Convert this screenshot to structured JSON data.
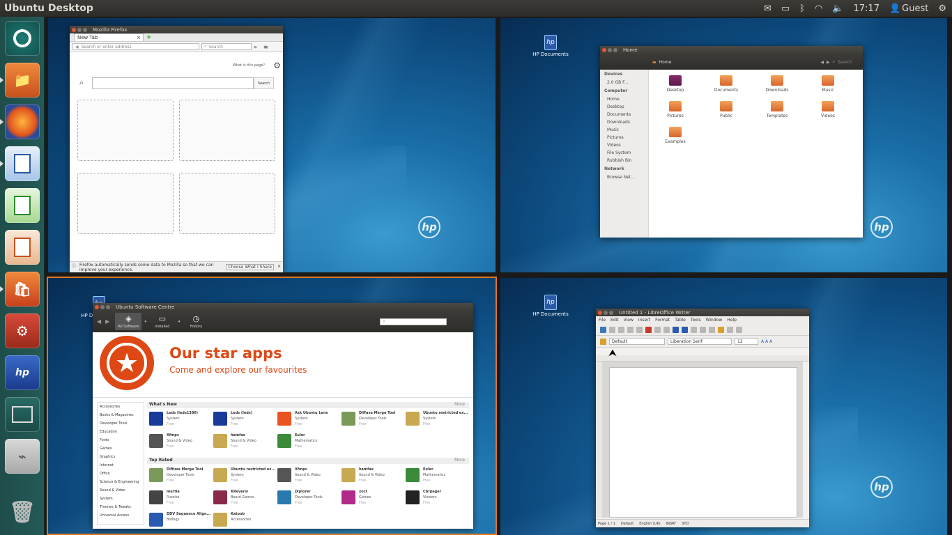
{
  "panel": {
    "title": "Ubuntu Desktop",
    "time": "17:17",
    "user": "Guest"
  },
  "launcher": {
    "items": [
      "Dash Home",
      "Files",
      "Firefox Web Browser",
      "LibreOffice Writer",
      "LibreOffice Calc",
      "LibreOffice Impress",
      "Ubuntu Software Centre",
      "System Settings",
      "HP Documents",
      "Workspace Switcher",
      "USB Drive",
      "Trash"
    ]
  },
  "desktop": {
    "hp_documents": "HP Documents",
    "hp_logo": "hp"
  },
  "firefox": {
    "title": "Mozilla Firefox",
    "tab": "New Tab",
    "address_placeholder": "Search or enter address",
    "search_placeholder": "Search",
    "whats_this": "What is this page?",
    "search_button": "Search",
    "notice": "Firefox automatically sends some data to Mozilla so that we can improve your experience.",
    "choose": "Choose What I Share"
  },
  "files": {
    "title": "Home",
    "breadcrumb": "Home",
    "search": "Search",
    "devices_h": "Devices",
    "device": "2.0 GB F...",
    "computer_h": "Computer",
    "computer": [
      "Home",
      "Desktop",
      "Documents",
      "Downloads",
      "Music",
      "Pictures",
      "Videos",
      "File System",
      "Rubbish Bin"
    ],
    "network_h": "Network",
    "network": [
      "Browse Net..."
    ],
    "folders": [
      "Desktop",
      "Documents",
      "Downloads",
      "Music",
      "Pictures",
      "Public",
      "Templates",
      "Videos",
      "Examples"
    ]
  },
  "software": {
    "title": "Ubuntu Software Centre",
    "nav": [
      "All Software",
      "Installed",
      "History"
    ],
    "banner_title": "Our star apps",
    "banner_sub": "Come and explore our favourites",
    "categories": [
      "Accessories",
      "Books & Magazines",
      "Developer Tools",
      "Education",
      "Fonts",
      "Games",
      "Graphics",
      "Internet",
      "Office",
      "Science & Engineering",
      "Sound & Video",
      "System",
      "Themes & Tweaks",
      "Universal Access"
    ],
    "whats_new": "What's New",
    "top_rated": "Top Rated",
    "more": "More",
    "new_apps": [
      {
        "name": "Leds (leds1386)",
        "cat": "System",
        "price": "Free",
        "color": "#1a3a9a"
      },
      {
        "name": "Leds (leds)",
        "cat": "System",
        "price": "Free",
        "color": "#1a3a9a"
      },
      {
        "name": "Ask Ubuntu Lens",
        "cat": "System",
        "price": "Free",
        "color": "#e95420"
      },
      {
        "name": "Diffuse Merge Tool",
        "cat": "Developer Tools",
        "price": "Free",
        "color": "#7a9a5a"
      },
      {
        "name": "Ubuntu restricted ex...",
        "cat": "System",
        "price": "Free",
        "color": "#c8a850"
      },
      {
        "name": "Xfmpc",
        "cat": "Sound & Video",
        "price": "Free",
        "color": "#555"
      },
      {
        "name": "hamfax",
        "cat": "Sound & Video",
        "price": "Free",
        "color": "#c8a850"
      },
      {
        "name": "Euler",
        "cat": "Mathematics",
        "price": "Free",
        "color": "#3a8a3a"
      }
    ],
    "top_apps": [
      {
        "name": "Diffuse Merge Tool",
        "cat": "Developer Tools",
        "price": "Free",
        "color": "#7a9a5a"
      },
      {
        "name": "Ubuntu restricted ex...",
        "cat": "System",
        "price": "Free",
        "color": "#c8a850"
      },
      {
        "name": "Xfmpc",
        "cat": "Sound & Video",
        "price": "Free",
        "color": "#555"
      },
      {
        "name": "hamfax",
        "cat": "Sound & Video",
        "price": "Free",
        "color": "#c8a850"
      },
      {
        "name": "Euler",
        "cat": "Mathematics",
        "price": "Free",
        "color": "#3a8a3a"
      },
      {
        "name": "Inertia",
        "cat": "Puzzles",
        "price": "Free",
        "color": "#444"
      },
      {
        "name": "KReversi",
        "cat": "Board Games",
        "price": "Free",
        "color": "#8a2a4a"
      },
      {
        "name": "JXplorer",
        "cat": "Developer Tools",
        "price": "Free",
        "color": "#2a7ab0"
      },
      {
        "name": "xoct",
        "cat": "Games",
        "price": "Free",
        "color": "#b02a8a"
      },
      {
        "name": "Cbrpager",
        "cat": "Viewers",
        "price": "Free",
        "color": "#222"
      },
      {
        "name": "DDV Sequence Align...",
        "cat": "Biology",
        "price": "",
        "color": "#2a5ab0"
      },
      {
        "name": "Katoob",
        "cat": "Accessories",
        "price": "",
        "color": "#c8a850"
      }
    ]
  },
  "writer": {
    "title": "Untitled 1 - LibreOffice Writer",
    "menu": [
      "File",
      "Edit",
      "View",
      "Insert",
      "Format",
      "Table",
      "Tools",
      "Window",
      "Help"
    ],
    "style": "Default",
    "font": "Liberation Serif",
    "size": "12",
    "status": [
      "Page 1 / 1",
      "Default",
      "English (UK)",
      "INSRT",
      "STD"
    ]
  }
}
